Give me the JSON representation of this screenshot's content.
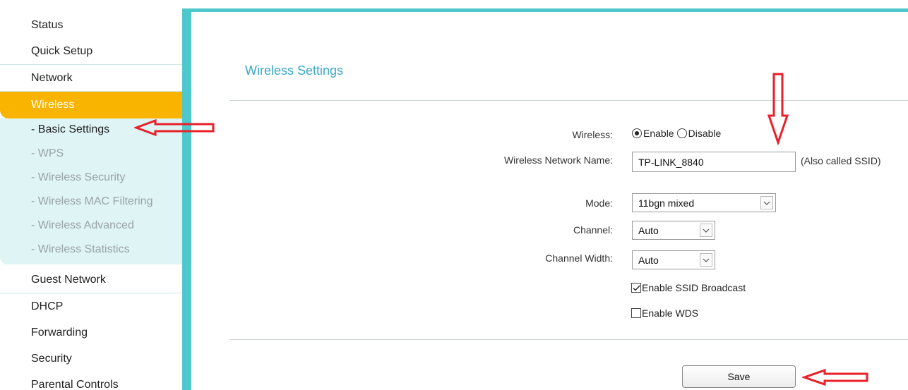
{
  "sidebar": {
    "items": [
      {
        "label": "Status"
      },
      {
        "label": "Quick Setup"
      },
      {
        "label": "Network"
      },
      {
        "label": "Wireless"
      },
      {
        "label": "Guest Network"
      },
      {
        "label": "DHCP"
      },
      {
        "label": "Forwarding"
      },
      {
        "label": "Security"
      },
      {
        "label": "Parental Controls"
      }
    ],
    "submenu": [
      {
        "label": "- Basic Settings"
      },
      {
        "label": "- WPS"
      },
      {
        "label": "- Wireless Security"
      },
      {
        "label": "- Wireless MAC Filtering"
      },
      {
        "label": "- Wireless Advanced"
      },
      {
        "label": "- Wireless Statistics"
      }
    ]
  },
  "main": {
    "title": "Wireless Settings",
    "wireless_label": "Wireless:",
    "enable_label": "Enable",
    "disable_label": "Disable",
    "network_name_label": "Wireless Network Name:",
    "network_name_value": "TP-LINK_8840",
    "ssid_hint": "(Also called SSID)",
    "mode_label": "Mode:",
    "mode_value": "11bgn mixed",
    "channel_label": "Channel:",
    "channel_value": "Auto",
    "channel_width_label": "Channel Width:",
    "channel_width_value": "Auto",
    "ssid_broadcast_label": "Enable SSID Broadcast",
    "wds_label": "Enable WDS",
    "save_label": "Save"
  },
  "colors": {
    "accent": "#4ec8cc",
    "active_menu": "#f9b400",
    "title": "#3aa7c7",
    "annotation": "#e8202a"
  }
}
